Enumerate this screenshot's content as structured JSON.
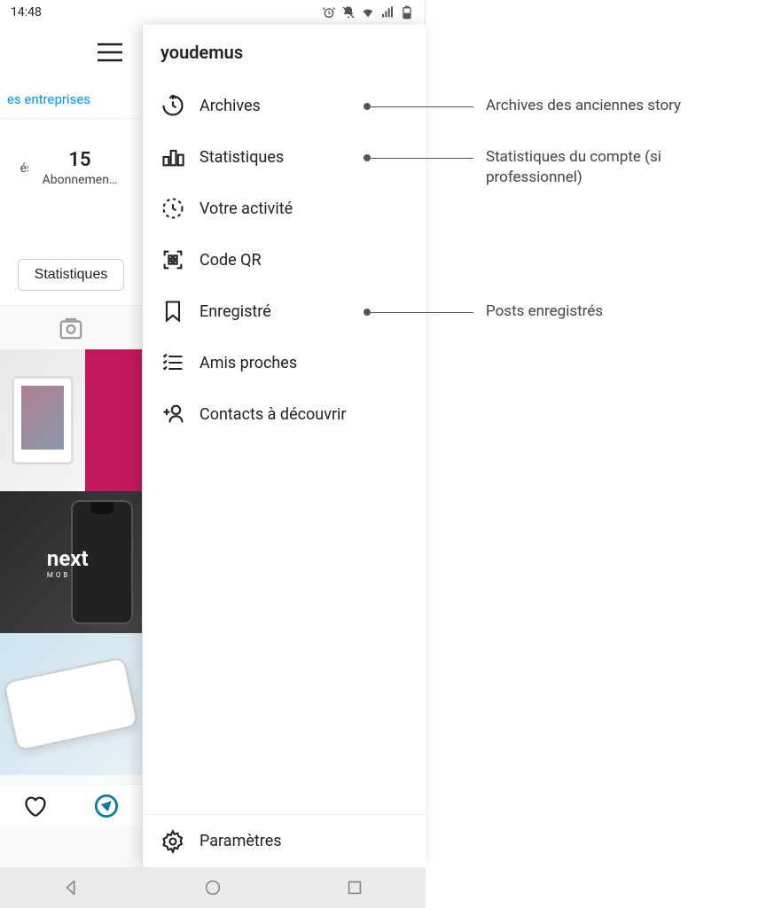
{
  "status": {
    "time": "14:48"
  },
  "profile": {
    "link_partial": "es entreprises",
    "stat_count": "15",
    "stat_label_partial": "Abonnemen…",
    "stat_left_partial": "és",
    "stats_button": "Statistiques",
    "post2_brand": "next",
    "post2_sub": "MOBILES"
  },
  "drawer": {
    "username": "youdemus",
    "items": [
      {
        "label": "Archives"
      },
      {
        "label": "Statistiques"
      },
      {
        "label": "Votre activité"
      },
      {
        "label": "Code QR"
      },
      {
        "label": "Enregistré"
      },
      {
        "label": "Amis proches"
      },
      {
        "label": "Contacts à découvrir"
      }
    ],
    "footer": "Paramètres"
  },
  "annotations": {
    "a1": "Archives des anciennes story",
    "a2": "Statistiques du compte (si professionnel)",
    "a3": "Posts enregistrés"
  }
}
